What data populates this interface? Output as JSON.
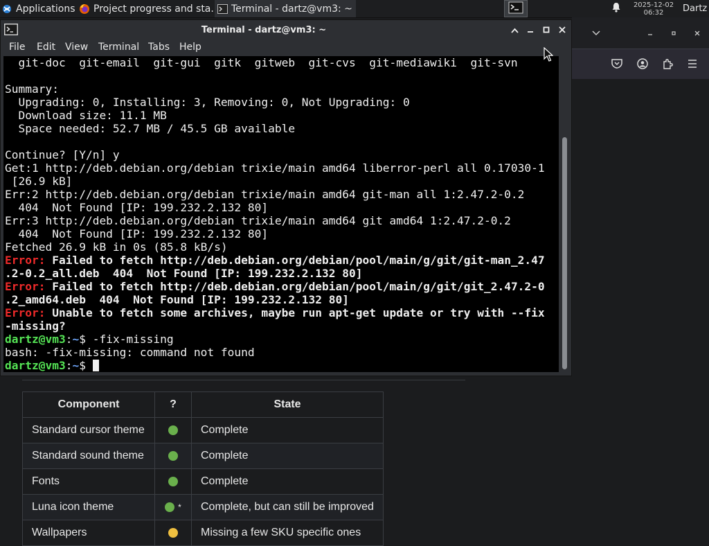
{
  "colors": {
    "panel_bg": "#1d1e20",
    "terminal_bg": "#000000",
    "error_red": "#ef2a2a",
    "prompt_green": "#55e455",
    "path_blue": "#6a9ff0",
    "dot_green": "#6ab04c",
    "dot_yellow": "#f0c040"
  },
  "panel": {
    "applications_label": "Applications",
    "applications_icon": "xfce-mouse-icon",
    "tasks": [
      {
        "label": "Project progress and sta...",
        "icon": "firefox-icon"
      },
      {
        "label": "Terminal - dartz@vm3: ~",
        "icon": "terminal-icon"
      }
    ],
    "date": "2025-12-02",
    "time": "06:32",
    "user": "Dartz"
  },
  "terminal": {
    "title": "Terminal - dartz@vm3: ~",
    "menu": [
      "File",
      "Edit",
      "View",
      "Terminal",
      "Tabs",
      "Help"
    ],
    "lines": [
      {
        "segs": [
          {
            "t": "  git-doc  git-email  git-gui  gitk  gitweb  git-cvs  git-mediawiki  git-svn"
          }
        ]
      },
      {
        "segs": [
          {
            "t": ""
          }
        ]
      },
      {
        "segs": [
          {
            "t": "Summary:"
          }
        ]
      },
      {
        "segs": [
          {
            "t": "  Upgrading: 0, Installing: 3, Removing: 0, Not Upgrading: 0"
          }
        ]
      },
      {
        "segs": [
          {
            "t": "  Download size: 11.1 MB"
          }
        ]
      },
      {
        "segs": [
          {
            "t": "  Space needed: 52.7 MB / 45.5 GB available"
          }
        ]
      },
      {
        "segs": [
          {
            "t": ""
          }
        ]
      },
      {
        "segs": [
          {
            "t": "Continue? [Y/n] y"
          }
        ]
      },
      {
        "segs": [
          {
            "t": "Get:1 http://deb.debian.org/debian trixie/main amd64 liberror-perl all 0.17030-1"
          }
        ]
      },
      {
        "segs": [
          {
            "t": " [26.9 kB]"
          }
        ]
      },
      {
        "segs": [
          {
            "t": "Err:2 http://deb.debian.org/debian trixie/main amd64 git-man all 1:2.47.2-0.2"
          }
        ]
      },
      {
        "segs": [
          {
            "t": "  404  Not Found [IP: 199.232.2.132 80]"
          }
        ]
      },
      {
        "segs": [
          {
            "t": "Err:3 http://deb.debian.org/debian trixie/main amd64 git amd64 1:2.47.2-0.2"
          }
        ]
      },
      {
        "segs": [
          {
            "t": "  404  Not Found [IP: 199.232.2.132 80]"
          }
        ]
      },
      {
        "segs": [
          {
            "t": "Fetched 26.9 kB in 0s (85.8 kB/s)"
          }
        ]
      },
      {
        "segs": [
          {
            "t": "Error:",
            "c": "err"
          },
          {
            "t": " Failed to fetch http://deb.debian.org/debian/pool/main/g/git/git-man_2.47",
            "c": "b"
          }
        ]
      },
      {
        "segs": [
          {
            "t": ".2-0.2_all.deb  404  Not Found [IP: 199.232.2.132 80]",
            "c": "b"
          }
        ]
      },
      {
        "segs": [
          {
            "t": "Error:",
            "c": "err"
          },
          {
            "t": " Failed to fetch http://deb.debian.org/debian/pool/main/g/git/git_2.47.2-0",
            "c": "b"
          }
        ]
      },
      {
        "segs": [
          {
            "t": ".2_amd64.deb  404  Not Found [IP: 199.232.2.132 80]",
            "c": "b"
          }
        ]
      },
      {
        "segs": [
          {
            "t": "Error:",
            "c": "err"
          },
          {
            "t": " Unable to fetch some archives, maybe run apt-get update or try with --fix",
            "c": "b"
          }
        ]
      },
      {
        "segs": [
          {
            "t": "-missing?",
            "c": "b"
          }
        ]
      },
      {
        "segs": [
          {
            "t": "dartz@vm3",
            "c": "prompt"
          },
          {
            "t": ":"
          },
          {
            "t": "~",
            "c": "path"
          },
          {
            "t": "$ -fix-missing"
          }
        ]
      },
      {
        "segs": [
          {
            "t": "bash: -fix-missing: command not found"
          }
        ]
      },
      {
        "segs": [
          {
            "t": "dartz@vm3",
            "c": "prompt"
          },
          {
            "t": ":"
          },
          {
            "t": "~",
            "c": "path"
          },
          {
            "t": "$ "
          }
        ],
        "cursor": true
      }
    ]
  },
  "web_table": {
    "headers": [
      "Component",
      "?",
      "State"
    ],
    "rows": [
      {
        "component": "Standard cursor theme",
        "status": "green",
        "marker": "",
        "state": "Complete"
      },
      {
        "component": "Standard sound theme",
        "status": "green",
        "marker": "",
        "state": "Complete"
      },
      {
        "component": "Fonts",
        "status": "green",
        "marker": "",
        "state": "Complete"
      },
      {
        "component": "Luna icon theme",
        "status": "green",
        "marker": "*",
        "state": "Complete, but can still be improved"
      },
      {
        "component": "Wallpapers",
        "status": "yellow",
        "marker": "",
        "state": "Missing a few SKU specific ones"
      }
    ]
  }
}
